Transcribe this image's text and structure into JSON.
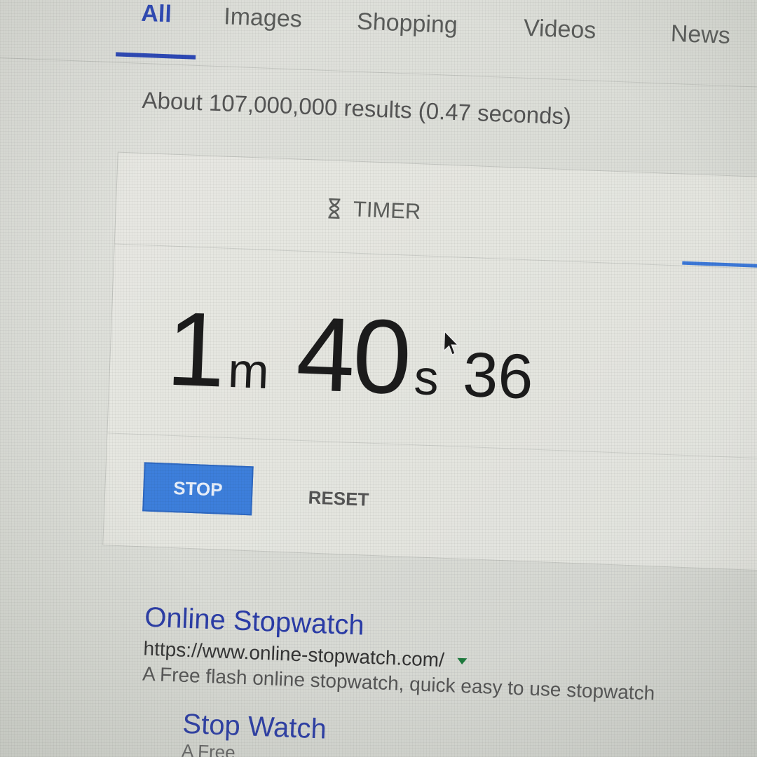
{
  "tabs": [
    {
      "label": "All",
      "active": true
    },
    {
      "label": "Images",
      "active": false
    },
    {
      "label": "Shopping",
      "active": false
    },
    {
      "label": "Videos",
      "active": false
    },
    {
      "label": "News",
      "active": false
    }
  ],
  "result_stats": "About 107,000,000 results (0.47 seconds)",
  "timer": {
    "tab_label": "TIMER",
    "tab_icon": "hourglass-icon",
    "minutes": "1",
    "minutes_unit": "m",
    "seconds": "40",
    "seconds_unit": "s",
    "centiseconds": "36",
    "stop_label": "STOP",
    "reset_label": "RESET"
  },
  "results": [
    {
      "title": "Online Stopwatch",
      "url": "https://www.online-stopwatch.com/",
      "snippet": "A Free flash online stopwatch, quick easy to use stopwatch"
    }
  ],
  "sub_result": {
    "title": "Stop Watch",
    "snippet": "A Free"
  },
  "colors": {
    "accent": "#2a46b8",
    "button_blue": "#3d7fdc",
    "link": "#2a3ca8"
  }
}
